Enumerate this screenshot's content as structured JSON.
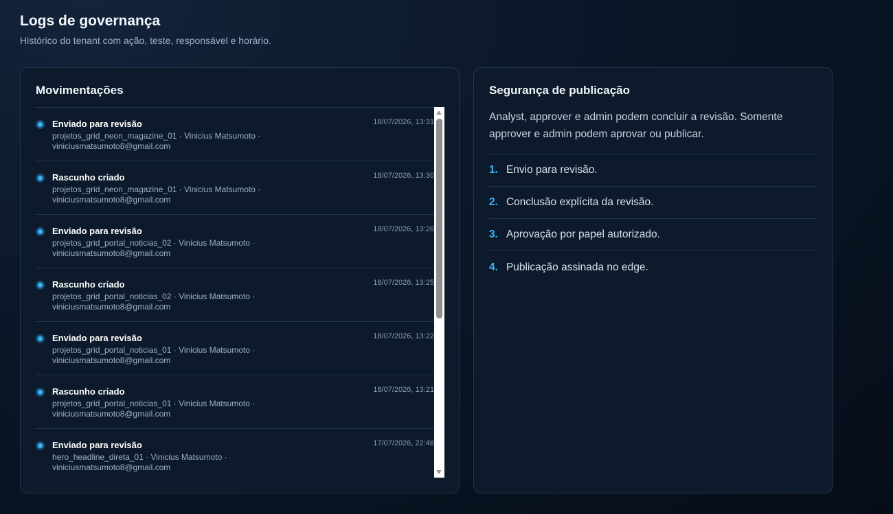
{
  "header": {
    "title": "Logs de governança",
    "subtitle": "Histórico do tenant com ação, teste, responsável e horário."
  },
  "movements": {
    "title": "Movimentações",
    "items": [
      {
        "action": "Enviado para revisão",
        "project": "projetos_grid_neon_magazine_01",
        "user": "Vinicius Matsumoto",
        "email": "viniciusmatsumoto8@gmail.com",
        "time": "18/07/2026, 13:31",
        "detail_line1": "projetos_grid_neon_magazine_01 · Vinicius Matsumoto ·"
      },
      {
        "action": "Rascunho criado",
        "project": "projetos_grid_neon_magazine_01",
        "user": "Vinicius Matsumoto",
        "email": "viniciusmatsumoto8@gmail.com",
        "time": "18/07/2026, 13:30",
        "detail_line1": "projetos_grid_neon_magazine_01 · Vinicius Matsumoto ·"
      },
      {
        "action": "Enviado para revisão",
        "project": "projetos_grid_portal_noticias_02",
        "user": "Vinicius Matsumoto",
        "email": "viniciusmatsumoto8@gmail.com",
        "time": "18/07/2026, 13:26",
        "detail_line1": "projetos_grid_portal_noticias_02 · Vinicius Matsumoto ·"
      },
      {
        "action": "Rascunho criado",
        "project": "projetos_grid_portal_noticias_02",
        "user": "Vinicius Matsumoto",
        "email": "viniciusmatsumoto8@gmail.com",
        "time": "18/07/2026, 13:25",
        "detail_line1": "projetos_grid_portal_noticias_02 · Vinicius Matsumoto ·"
      },
      {
        "action": "Enviado para revisão",
        "project": "projetos_grid_portal_noticias_01",
        "user": "Vinicius Matsumoto",
        "email": "viniciusmatsumoto8@gmail.com",
        "time": "18/07/2026, 13:22",
        "detail_line1": "projetos_grid_portal_noticias_01 · Vinicius Matsumoto ·"
      },
      {
        "action": "Rascunho criado",
        "project": "projetos_grid_portal_noticias_01",
        "user": "Vinicius Matsumoto",
        "email": "viniciusmatsumoto8@gmail.com",
        "time": "18/07/2026, 13:21",
        "detail_line1": "projetos_grid_portal_noticias_01 · Vinicius Matsumoto ·"
      },
      {
        "action": "Enviado para revisão",
        "project": "hero_headline_direta_01",
        "user": "Vinicius Matsumoto",
        "email": "viniciusmatsumoto8@gmail.com",
        "time": "17/07/2026, 22:46",
        "detail_line1": "hero_headline_direta_01 · Vinicius Matsumoto ·"
      }
    ]
  },
  "security": {
    "title": "Segurança de publicação",
    "description": "Analyst, approver e admin podem concluir a revisão. Somente approver e admin podem aprovar ou publicar.",
    "steps": [
      {
        "num": "1.",
        "text": "Envio para revisão."
      },
      {
        "num": "2.",
        "text": "Conclusão explícita da revisão."
      },
      {
        "num": "3.",
        "text": "Aprovação por papel autorizado."
      },
      {
        "num": "4.",
        "text": "Publicação assinada no edge."
      }
    ]
  },
  "colors": {
    "accent": "#38b6f5",
    "card_bg": "#0c1a2b",
    "border": "#22364d"
  }
}
